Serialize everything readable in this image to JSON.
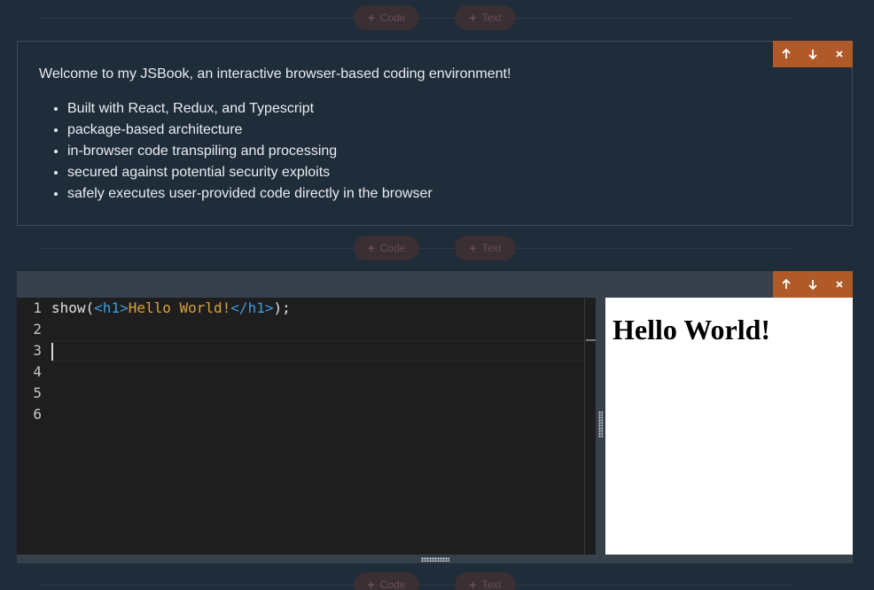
{
  "add_cell": {
    "code_label": "Code",
    "text_label": "Text"
  },
  "cell_toolbar": {
    "up_icon": "arrow-up-icon",
    "down_icon": "arrow-down-icon",
    "delete_icon": "close-icon"
  },
  "text_cell": {
    "intro": "Welcome to my JSBook, an interactive browser-based coding environment!",
    "bullets": [
      "Built with React, Redux, and Typescript",
      "package-based architecture",
      "in-browser code transpiling and processing",
      "secured against potential security exploits",
      "safely executes user-provided code directly in the browser"
    ]
  },
  "code_cell": {
    "line_numbers": [
      "1",
      "2",
      "3",
      "4",
      "5",
      "6"
    ],
    "code_line_1": {
      "fn": "show(",
      "open_tag": "<h1>",
      "text": "Hello World!",
      "close_tag": "</h1>",
      "end": ");"
    },
    "preview_heading": "Hello World!"
  },
  "colors": {
    "background": "#1f2c3a",
    "toolbar_accent": "#b05a2a",
    "editor_bg": "#1e1e1e",
    "tag_color": "#3e9ce0",
    "string_color": "#d9a23a"
  }
}
